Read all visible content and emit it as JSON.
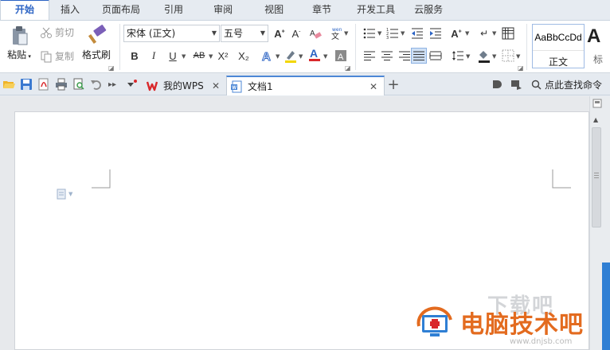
{
  "menu_tabs": [
    {
      "label": "开始",
      "active": true
    },
    {
      "label": "插入"
    },
    {
      "label": "页面布局"
    },
    {
      "label": "引用"
    },
    {
      "label": "审阅"
    },
    {
      "label": "视图"
    },
    {
      "label": "章节"
    },
    {
      "label": "开发工具"
    },
    {
      "label": "云服务"
    }
  ],
  "clipboard": {
    "paste": "粘贴",
    "cut": "剪切",
    "copy": "复制",
    "format_painter": "格式刷"
  },
  "font": {
    "name": "宋体 (正文)",
    "size": "五号",
    "bold": "B",
    "italic": "I",
    "underline": "U",
    "strike": "AB",
    "superscript": "X²",
    "subscript": "X₂"
  },
  "styles": {
    "sample": "AaBbCcDd",
    "normal": "正文",
    "big_sample": "A",
    "next_label": "标"
  },
  "doc_tabs": [
    {
      "label": "我的WPS"
    },
    {
      "label": "文档1",
      "active": true
    }
  ],
  "search_command": "点此查找命令",
  "watermark": {
    "brand": "电脑技术吧",
    "ghost": "下载吧",
    "url": "www.dnjsb.com"
  },
  "colors": {
    "accent": "#2b63c4",
    "wps_red": "#d9282b",
    "watermark": "#e36b1f",
    "highlight": "#f2d600",
    "font_color": "#d9282b"
  }
}
